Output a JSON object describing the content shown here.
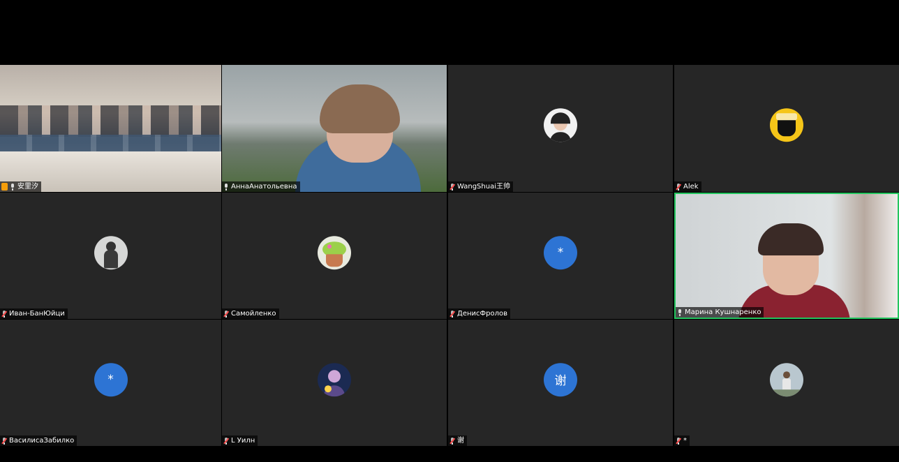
{
  "participants": [
    {
      "name": "安里汐",
      "kind": "video-classroom",
      "mic": "on",
      "host": true
    },
    {
      "name": "АннаАнатольевна",
      "kind": "video-outdoor",
      "mic": "on"
    },
    {
      "name": "WangShuai王帅",
      "kind": "avatar-photo",
      "mic": "muted"
    },
    {
      "name": "Alek",
      "kind": "avatar-logo",
      "mic": "muted"
    },
    {
      "name": "Иван-БанЮйци",
      "kind": "avatar-photo",
      "mic": "muted"
    },
    {
      "name": "Самойленко",
      "kind": "avatar-photo",
      "mic": "muted"
    },
    {
      "name": "ДенисФролов",
      "kind": "avatar-initial",
      "initial": "*",
      "mic": "muted"
    },
    {
      "name": "Марина Кушнаренко",
      "kind": "video-room",
      "mic": "on",
      "active": true
    },
    {
      "name": "ВасилисаЗабилко",
      "kind": "avatar-initial",
      "initial": "*",
      "mic": "muted"
    },
    {
      "name": "L Уилн",
      "kind": "avatar-photo",
      "mic": "muted"
    },
    {
      "name": "谢",
      "kind": "avatar-initial",
      "initial": "谢",
      "mic": "muted"
    },
    {
      "name": "*",
      "kind": "avatar-photo",
      "mic": "muted"
    }
  ],
  "colors": {
    "tile_bg": "#262626",
    "avatar_blue": "#2d74d4",
    "active_speaker_border": "#22c55e",
    "host_badge": "#f59e0b"
  }
}
